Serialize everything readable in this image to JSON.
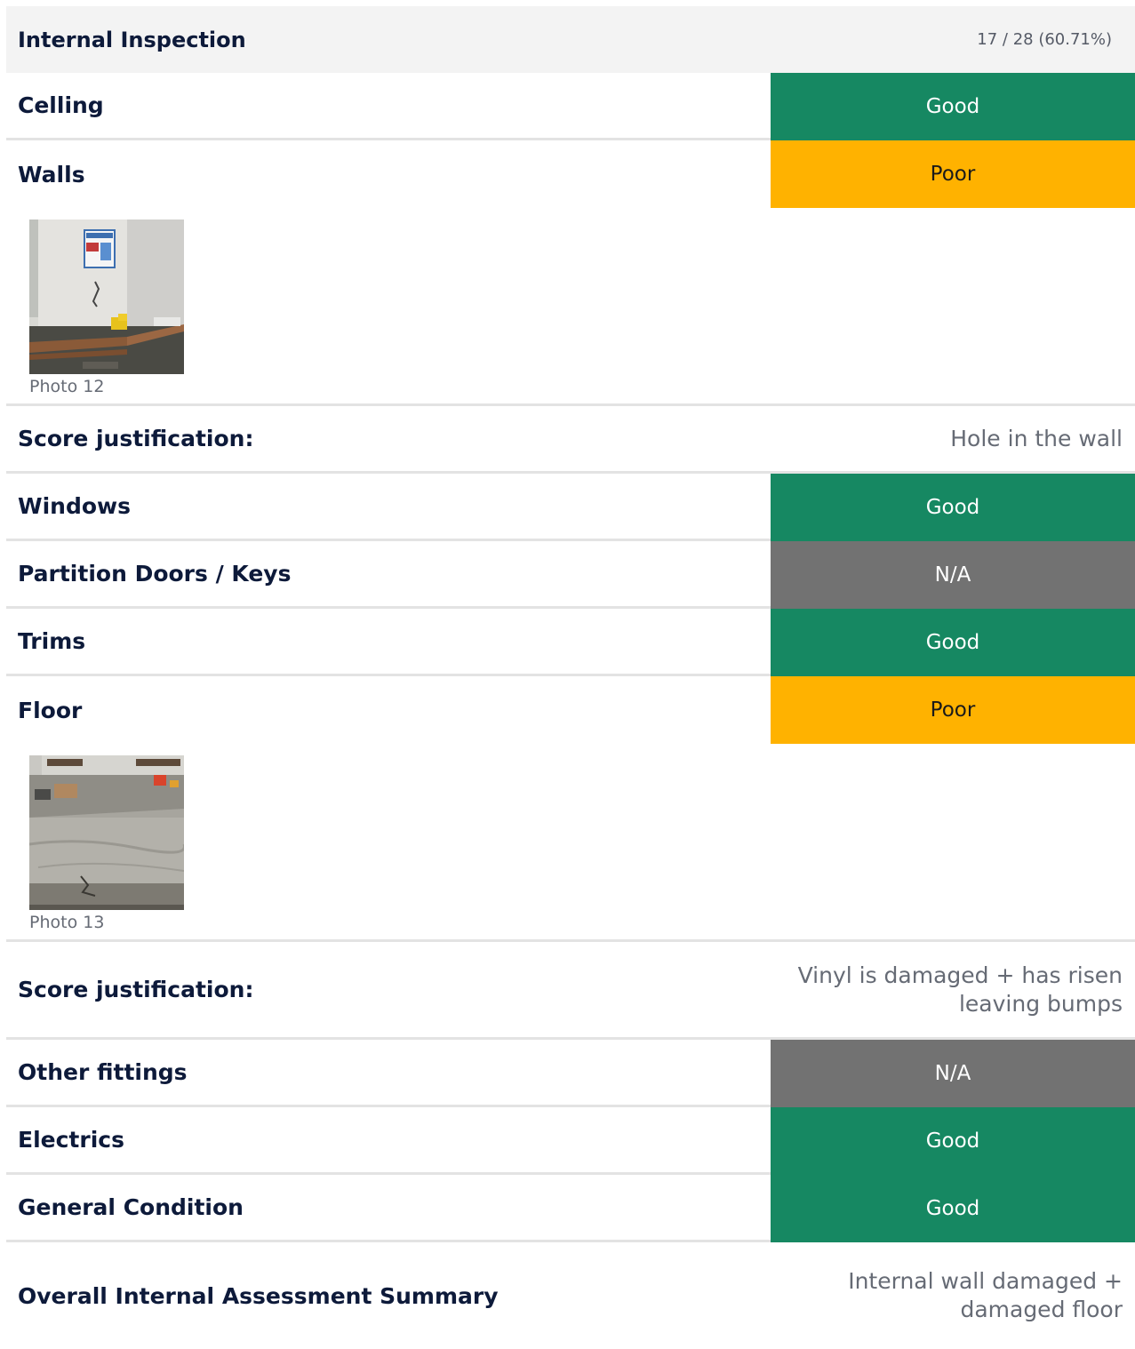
{
  "section": {
    "title": "Internal Inspection",
    "score": "17 / 28 (60.71%)"
  },
  "items": {
    "ceiling": {
      "label": "Celling",
      "rating": "Good"
    },
    "walls": {
      "label": "Walls",
      "rating": "Poor",
      "photo_caption": "Photo 12",
      "justification_label": "Score justification:",
      "justification": "Hole in the wall"
    },
    "windows": {
      "label": "Windows",
      "rating": "Good"
    },
    "partition_doors": {
      "label": "Partition Doors / Keys",
      "rating": "N/A"
    },
    "trims": {
      "label": "Trims",
      "rating": "Good"
    },
    "floor": {
      "label": "Floor",
      "rating": "Poor",
      "photo_caption": "Photo 13",
      "justification_label": "Score justification:",
      "justification": "Vinyl is damaged + has risen leaving bumps"
    },
    "other_fittings": {
      "label": "Other fittings",
      "rating": "N/A"
    },
    "electrics": {
      "label": "Electrics",
      "rating": "Good"
    },
    "general_condition": {
      "label": "General Condition",
      "rating": "Good"
    }
  },
  "summary": {
    "label": "Overall Internal Assessment Summary",
    "text": "Internal wall damaged + damaged floor"
  },
  "colors": {
    "good": "#168862",
    "poor": "#ffb200",
    "na": "#727272",
    "heading_text": "#0d1a3a"
  }
}
